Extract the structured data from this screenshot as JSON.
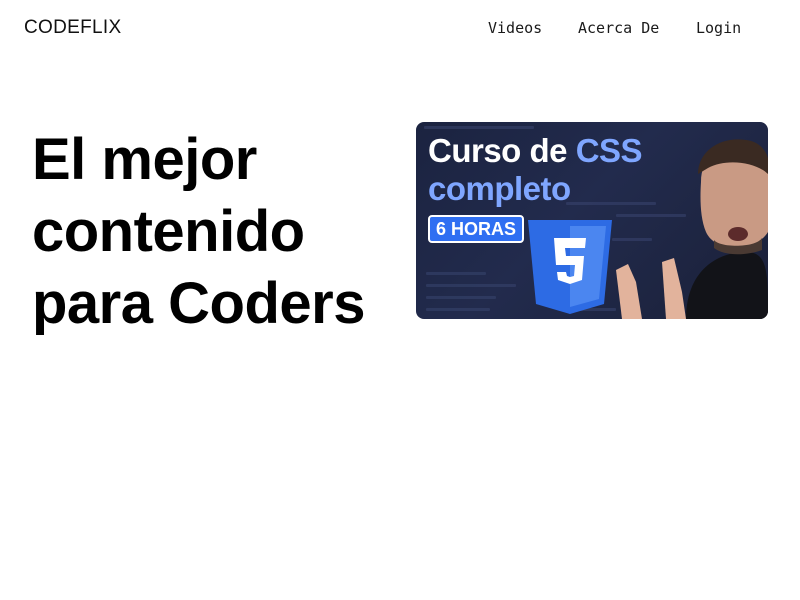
{
  "header": {
    "logo": "CODEFLIX",
    "nav": {
      "videos": "Videos",
      "about": "Acerca De",
      "login": "Login"
    }
  },
  "hero": {
    "title_lines": [
      "El mejor",
      "contenido",
      "para Coders"
    ]
  },
  "video": {
    "title_part1": "Curso de",
    "title_part2": "CSS",
    "title_line2": "completo",
    "badge": "6 HORAS",
    "logo_icon": "css3-logo-icon"
  },
  "colors": {
    "thumbnail_bg": "#1e2644",
    "accent": "#7fa6ff",
    "badge": "#2f6ff2",
    "css_shield": "#2d6be4"
  }
}
